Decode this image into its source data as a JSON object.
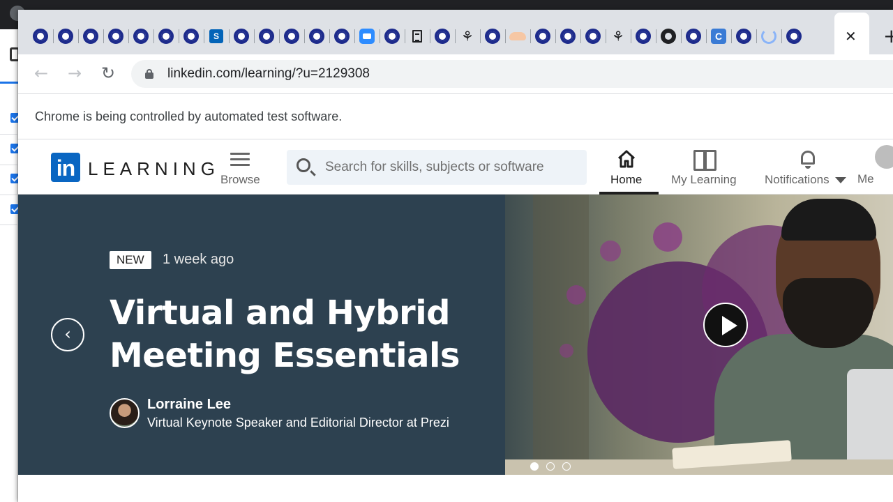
{
  "browser": {
    "url": "linkedin.com/learning/?u=2129308",
    "infobar_text": "Chrome is being controlled by automated test software."
  },
  "header": {
    "logo_text": "LEARNING",
    "logo_mark": "in",
    "browse_label": "Browse",
    "search_placeholder": "Search for skills, subjects or software",
    "nav": {
      "home_label": "Home",
      "my_learning_label": "My Learning",
      "notifications_label": "Notifications",
      "me_label": "Me"
    }
  },
  "hero": {
    "badge": "NEW",
    "posted": "1 week ago",
    "title": "Virtual and Hybrid Meeting Essentials",
    "author_name": "Lorraine Lee",
    "author_title": "Virtual Keynote Speaker and Editorial Director at Prezi",
    "prev_glyph": "‹",
    "carousel_active_index": 0,
    "carousel_count": 3
  },
  "icons": {
    "tab_favicons": [
      "ring",
      "ring",
      "ring",
      "ring",
      "ring",
      "ring",
      "ring",
      "sharepoint",
      "ring",
      "ring",
      "ring",
      "ring",
      "ring",
      "zoom",
      "ring",
      "doc",
      "ring",
      "tree",
      "ring",
      "cloud",
      "ring",
      "ring",
      "ring",
      "tree",
      "ring",
      "github",
      "ring",
      "c-app",
      "ring",
      "swirl",
      "ring"
    ]
  },
  "colors": {
    "linkedin_blue": "#0a66c2",
    "hero_bg": "#2d4150",
    "tabstrip_bg": "#dee1e6"
  }
}
